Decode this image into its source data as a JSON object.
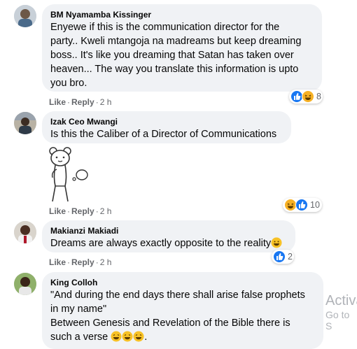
{
  "comments": [
    {
      "author": "BM Nyamamba Kissinger",
      "lines": [
        "Enyewe if this is the communication director for the",
        "party.. Kweli mtangoja na madreams but keep dreaming",
        "boss.. It's like you dreaming that Satan has taken over",
        "heaven... The way you translate this information is upto",
        "you bro."
      ],
      "like_label": "Like",
      "reply_label": "Reply",
      "time": "2 h",
      "reaction_count": "8",
      "reactions": [
        "like-reaction",
        "haha-reaction"
      ]
    },
    {
      "author": "Izak Ceo Mwangi",
      "lines": [
        "Is this the Caliber of a Director of Communications"
      ],
      "sticker": "thinking-bear-sticker",
      "like_label": "Like",
      "reply_label": "Reply",
      "time": "2 h",
      "reaction_count": "10",
      "reactions": [
        "haha-reaction",
        "like-reaction"
      ]
    },
    {
      "author": "Makianzi Makiadi",
      "lines": [
        "Dreams are always exactly opposite to the reality"
      ],
      "trailing_emoji": "grinning-emoji",
      "like_label": "Like",
      "reply_label": "Reply",
      "time": "2 h",
      "reaction_count": "2",
      "reactions": [
        "like-reaction"
      ]
    },
    {
      "author": "King Colloh",
      "lines": [
        "\"And during the end days there shall arise false prophets",
        "in my name\"",
        "Between Genesis and Revelation of the Bible there is",
        "such a verse"
      ],
      "trailing_emoji": "grinning-emoji",
      "trailing_text": "."
    }
  ],
  "separator": "·",
  "watermark": {
    "line1": "Activa",
    "line2": "Go to S"
  },
  "colors": {
    "bubble": "#f0f2f5",
    "like_blue": "#1877f2",
    "haha_yellow": "#f7b125",
    "secondary_text": "#65676b"
  }
}
